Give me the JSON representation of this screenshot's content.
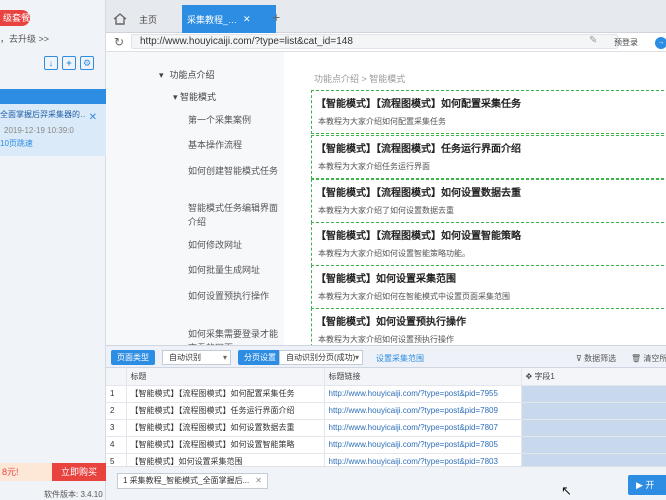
{
  "left": {
    "vip_label": "级套餐",
    "upgrade_text": "，去升级 >>",
    "task_title": "全面掌握后羿采集器的…",
    "task_date": "2019-12-19 10:39:0",
    "task_link": "10页跳速",
    "promo_price": "8元!",
    "promo_buy": "立即购买",
    "version": "软件版本: 3.4.10"
  },
  "tabs": {
    "home": "主页",
    "active": "采集教程_…"
  },
  "address": {
    "url": "http://www.houyicaiji.com/?type=list&cat_id=148",
    "preset": "预登录"
  },
  "web": {
    "nav_section": "功能点介绍",
    "nav_group": "智能模式",
    "nav_items": [
      "第一个采集案例",
      "基本操作流程",
      "如何创建智能模式任务",
      "智能模式任务编辑界面介绍",
      "如何修改网址",
      "如何批量生成网址",
      "如何设置预执行操作",
      "如何采集需要登录才能查看的网页"
    ],
    "breadcrumb": "功能点介绍 > 智能模式",
    "articles": [
      {
        "title": "【智能模式】【流程图模式】如何配置采集任务",
        "desc": "本教程为大家介绍如何配置采集任务"
      },
      {
        "title": "【智能模式】【流程图模式】任务运行界面介绍",
        "desc": "本教程为大家介绍任务运行界面"
      },
      {
        "title": "【智能模式】【流程图模式】如何设置数据去重",
        "desc": "本教程为大家介绍了如何设置数据去重"
      },
      {
        "title": "【智能模式】【流程图模式】如何设置智能策略",
        "desc": "本教程为大家介绍如何设置智能策略功能。"
      },
      {
        "title": "【智能模式】如何设置采集范围",
        "desc": "本教程为大家介绍如何在智能模式中设置页面采集范围"
      },
      {
        "title": "【智能模式】如何设置预执行操作",
        "desc": "本教程为大家介绍如何设置预执行操作"
      }
    ]
  },
  "toolbar": {
    "page_type_label": "页面类型",
    "page_type_value": "自动识别",
    "paging_label": "分页设置",
    "paging_value": "自动识别分页(成功)",
    "range_link": "设置采集范围",
    "filter": "数据筛选",
    "clear": "清空所有"
  },
  "grid": {
    "headers": [
      "",
      "标题",
      "标题链接",
      "字段1"
    ],
    "rows": [
      {
        "n": "1",
        "title": "【智能模式】【流程图模式】如何配置采集任务",
        "url": "http://www.houyicaiji.com/?type=post&pid=7955"
      },
      {
        "n": "2",
        "title": "【智能模式】【流程图模式】任务运行界面介绍",
        "url": "http://www.houyicaiji.com/?type=post&pid=7809"
      },
      {
        "n": "3",
        "title": "【智能模式】【流程图模式】如何设置数据去重",
        "url": "http://www.houyicaiji.com/?type=post&pid=7807"
      },
      {
        "n": "4",
        "title": "【智能模式】【流程图模式】如何设置智能策略",
        "url": "http://www.houyicaiji.com/?type=post&pid=7805"
      },
      {
        "n": "5",
        "title": "【智能模式】如何设置采集范围",
        "url": "http://www.houyicaiji.com/?type=post&pid=7803"
      }
    ]
  },
  "bottom": {
    "task_tab": "1  采集教程_智能模式_全面掌握后...",
    "start": "开"
  }
}
